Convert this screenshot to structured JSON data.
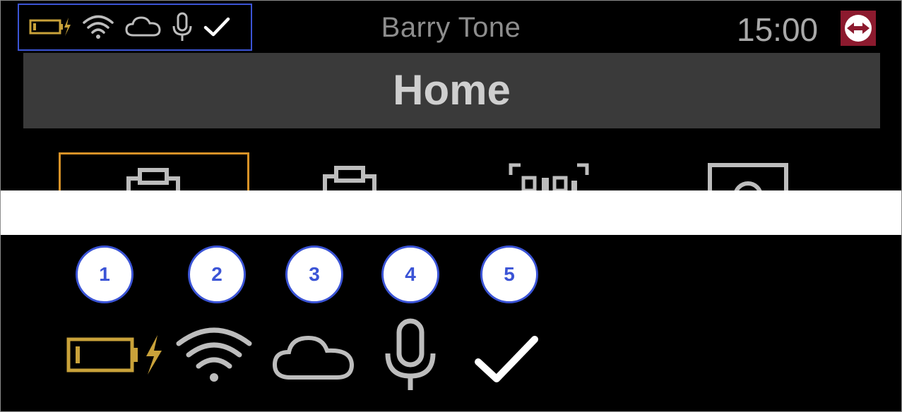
{
  "status_bar": {
    "icons": [
      "battery-charging-icon",
      "wifi-icon",
      "cloud-icon",
      "microphone-icon",
      "check-icon"
    ],
    "user_name": "Barry Tone",
    "time": "15:00",
    "logo": "teamviewer-logo"
  },
  "header": {
    "title": "Home"
  },
  "tiles": [
    "clipboard-icon",
    "clipboard-icon",
    "qr-scan-icon",
    "photo-icon"
  ],
  "legend": {
    "badges": [
      "1",
      "2",
      "3",
      "4",
      "5"
    ],
    "icons": [
      "battery-charging-icon",
      "wifi-icon",
      "cloud-icon",
      "microphone-icon",
      "check-icon"
    ]
  },
  "colors": {
    "accent_blue": "#3b54d6",
    "battery": "#c9a23a",
    "selected_tile": "#d79227",
    "logo_red": "#8c1a2e"
  }
}
